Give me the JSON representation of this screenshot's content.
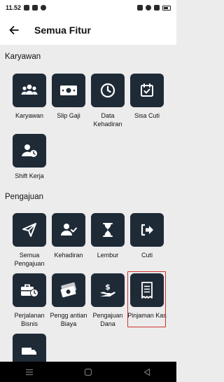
{
  "status_bar": {
    "time": "11.52"
  },
  "header": {
    "title": "Semua Fitur"
  },
  "sections": [
    {
      "title": "Karyawan",
      "items": [
        {
          "label": "Karyawan",
          "icon": "people-group-icon"
        },
        {
          "label": "Slip Gaji",
          "icon": "money-bill-icon"
        },
        {
          "label": "Data Kehadiran",
          "icon": "clock-icon"
        },
        {
          "label": "Sisa Cuti",
          "icon": "calendar-check-icon"
        },
        {
          "label": "Shift Kerja",
          "icon": "user-clock-icon"
        }
      ]
    },
    {
      "title": "Pengajuan",
      "items": [
        {
          "label": "Semua Pengajuan",
          "icon": "paper-plane-icon"
        },
        {
          "label": "Kehadiran",
          "icon": "user-check-icon"
        },
        {
          "label": "Lembur",
          "icon": "hourglass-icon"
        },
        {
          "label": "Cuti",
          "icon": "sign-out-icon"
        },
        {
          "label": "Perjalanan Bisnis",
          "icon": "briefcase-clock-icon"
        },
        {
          "label": "Pengg antian Biaya",
          "icon": "money-bills-icon"
        },
        {
          "label": "Pengajuan Dana",
          "icon": "hand-dollar-icon"
        },
        {
          "label": "Pinjaman Kas",
          "icon": "receipt-icon",
          "highlighted": true
        }
      ]
    }
  ],
  "colors": {
    "tile": "#1f2a37",
    "highlight": "#d0312d",
    "background": "#ececec"
  }
}
